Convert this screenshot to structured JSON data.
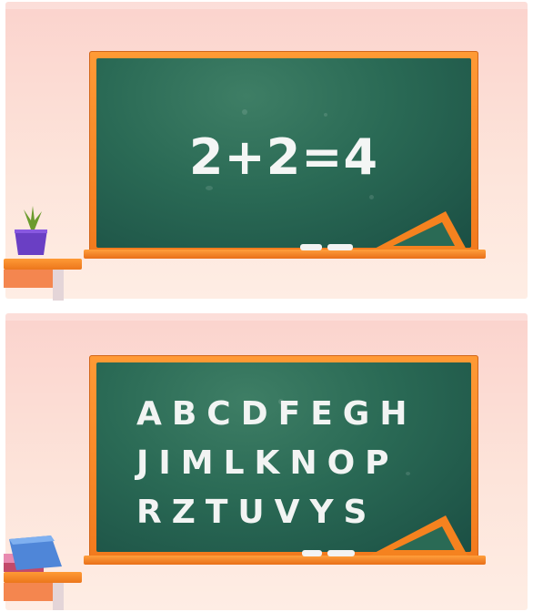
{
  "top_board": {
    "equation": "2+2=4"
  },
  "bottom_board": {
    "rows": [
      "ABCDFEGH",
      "JIMLKNOP",
      "RZTUVYS"
    ]
  },
  "colors": {
    "board": "#2a6a55",
    "frame": "#f5821f",
    "wall": "#fde4da",
    "chalk": "#f4f6f5"
  },
  "icons": [
    "potted-plant-icon",
    "books-icon",
    "set-square-icon",
    "chalk-icon"
  ]
}
